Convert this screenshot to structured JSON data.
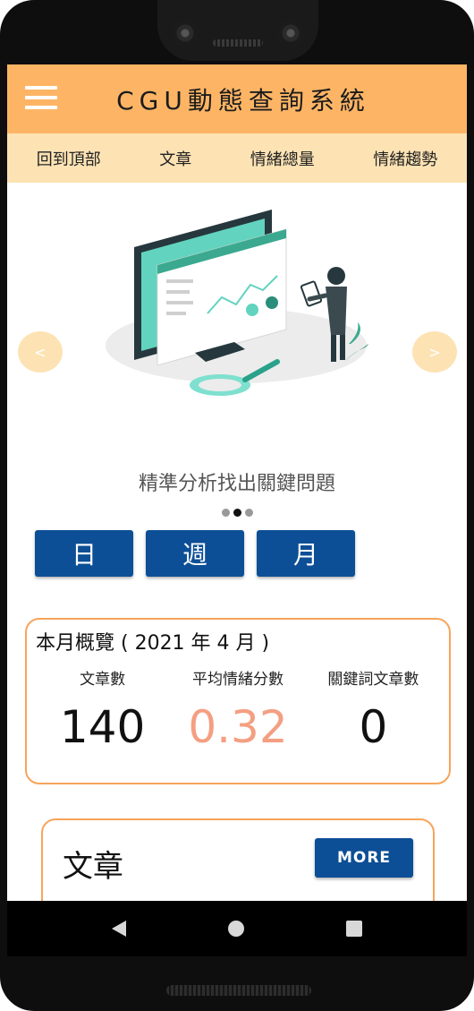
{
  "app": {
    "title": "CGU動態查詢系統"
  },
  "nav": {
    "items": [
      "回到頂部",
      "文章",
      "情緒總量",
      "情緒趨勢"
    ]
  },
  "carousel": {
    "prev_label": "<",
    "next_label": ">",
    "caption": "精準分析找出關鍵問題",
    "slide_count": 3,
    "active_index": 1
  },
  "range_buttons": {
    "day": "日",
    "week": "週",
    "month": "月"
  },
  "overview": {
    "title": "本月概覽 ( 2021 年 4 月 )",
    "stats": [
      {
        "label": "文章數",
        "value": "140"
      },
      {
        "label": "平均情緒分數",
        "value": "0.32"
      },
      {
        "label": "關鍵詞文章數",
        "value": "0"
      }
    ]
  },
  "articles": {
    "title": "文章",
    "more_label": "MORE"
  },
  "colors": {
    "appbar": "#fdb565",
    "nav": "#fde3b4",
    "primary_button": "#0d4f96",
    "card_border": "#f7a45a",
    "sentiment_value": "#f49f82"
  },
  "icons": {
    "menu": "hamburger-menu-icon",
    "back": "back-triangle-icon",
    "home": "home-circle-icon",
    "recent": "recent-apps-square-icon"
  }
}
